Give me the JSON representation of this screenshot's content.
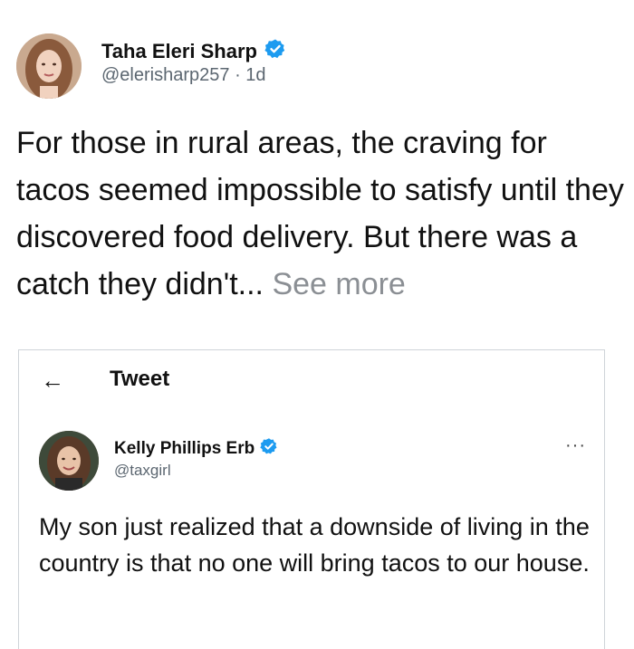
{
  "tweet": {
    "author_name": "Taha Eleri Sharp",
    "author_handle": "@elerisharp257",
    "separator": "·",
    "age": "1d",
    "text": "For those in rural areas, the craving for tacos seemed impossible to satisfy until they discovered food delivery. But there was a catch they didn't... ",
    "see_more_label": "See more",
    "icons": {
      "avatar": "person-avatar",
      "verified": "verified-badge-icon"
    }
  },
  "embedded": {
    "header": {
      "back_icon": "←",
      "title": "Tweet"
    },
    "author_name": "Kelly Phillips Erb",
    "author_handle": "@taxgirl",
    "more_label": "···",
    "text": "My son just realized that a downside of living in the country is that no one will bring tacos to our house.",
    "icons": {
      "back": "back-arrow-icon",
      "more": "more-options-icon",
      "verified": "verified-badge-icon"
    }
  },
  "colors": {
    "verified": "#1d9bf0",
    "muted_text": "#5b6670",
    "see_more": "#8b8f94",
    "border": "#cfd4d8"
  }
}
